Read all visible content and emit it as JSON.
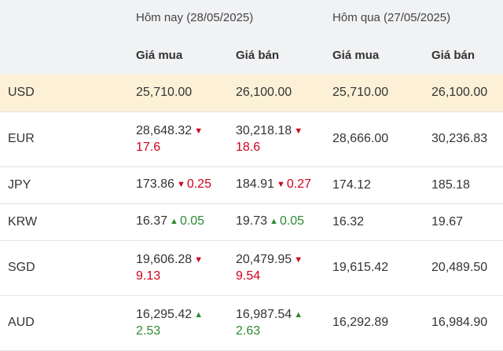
{
  "header": {
    "today": "Hôm nay (28/05/2025)",
    "yesterday": "Hôm qua (27/05/2025)",
    "buy": "Giá mua",
    "sell": "Giá bán"
  },
  "colors": {
    "down": "#d0021b",
    "up": "#2e8b32",
    "highlight": "#fcf1d7",
    "header_bg": "#f1f2f4"
  },
  "rows": [
    {
      "code": "USD",
      "buy": "25,710.00",
      "buy_dir": "none",
      "buy_chg": "",
      "sell": "26,100.00",
      "sell_dir": "none",
      "sell_chg": "",
      "y_buy": "25,710.00",
      "y_sell": "26,100.00"
    },
    {
      "code": "EUR",
      "buy": "28,648.32",
      "buy_dir": "down",
      "buy_chg": "17.6",
      "sell": "30,218.18",
      "sell_dir": "down",
      "sell_chg": "18.6",
      "y_buy": "28,666.00",
      "y_sell": "30,236.83"
    },
    {
      "code": "JPY",
      "buy": "173.86",
      "buy_dir": "down",
      "buy_chg": "0.25",
      "sell": "184.91",
      "sell_dir": "down",
      "sell_chg": "0.27",
      "y_buy": "174.12",
      "y_sell": "185.18"
    },
    {
      "code": "KRW",
      "buy": "16.37",
      "buy_dir": "up",
      "buy_chg": "0.05",
      "sell": "19.73",
      "sell_dir": "up",
      "sell_chg": "0.05",
      "y_buy": "16.32",
      "y_sell": "19.67"
    },
    {
      "code": "SGD",
      "buy": "19,606.28",
      "buy_dir": "down",
      "buy_chg": "9.13",
      "sell": "20,479.95",
      "sell_dir": "down",
      "sell_chg": "9.54",
      "y_buy": "19,615.42",
      "y_sell": "20,489.50"
    },
    {
      "code": "AUD",
      "buy": "16,295.42",
      "buy_dir": "up",
      "buy_chg": "2.53",
      "sell": "16,987.54",
      "sell_dir": "up",
      "sell_chg": "2.63",
      "y_buy": "16,292.89",
      "y_sell": "16,984.90"
    }
  ]
}
